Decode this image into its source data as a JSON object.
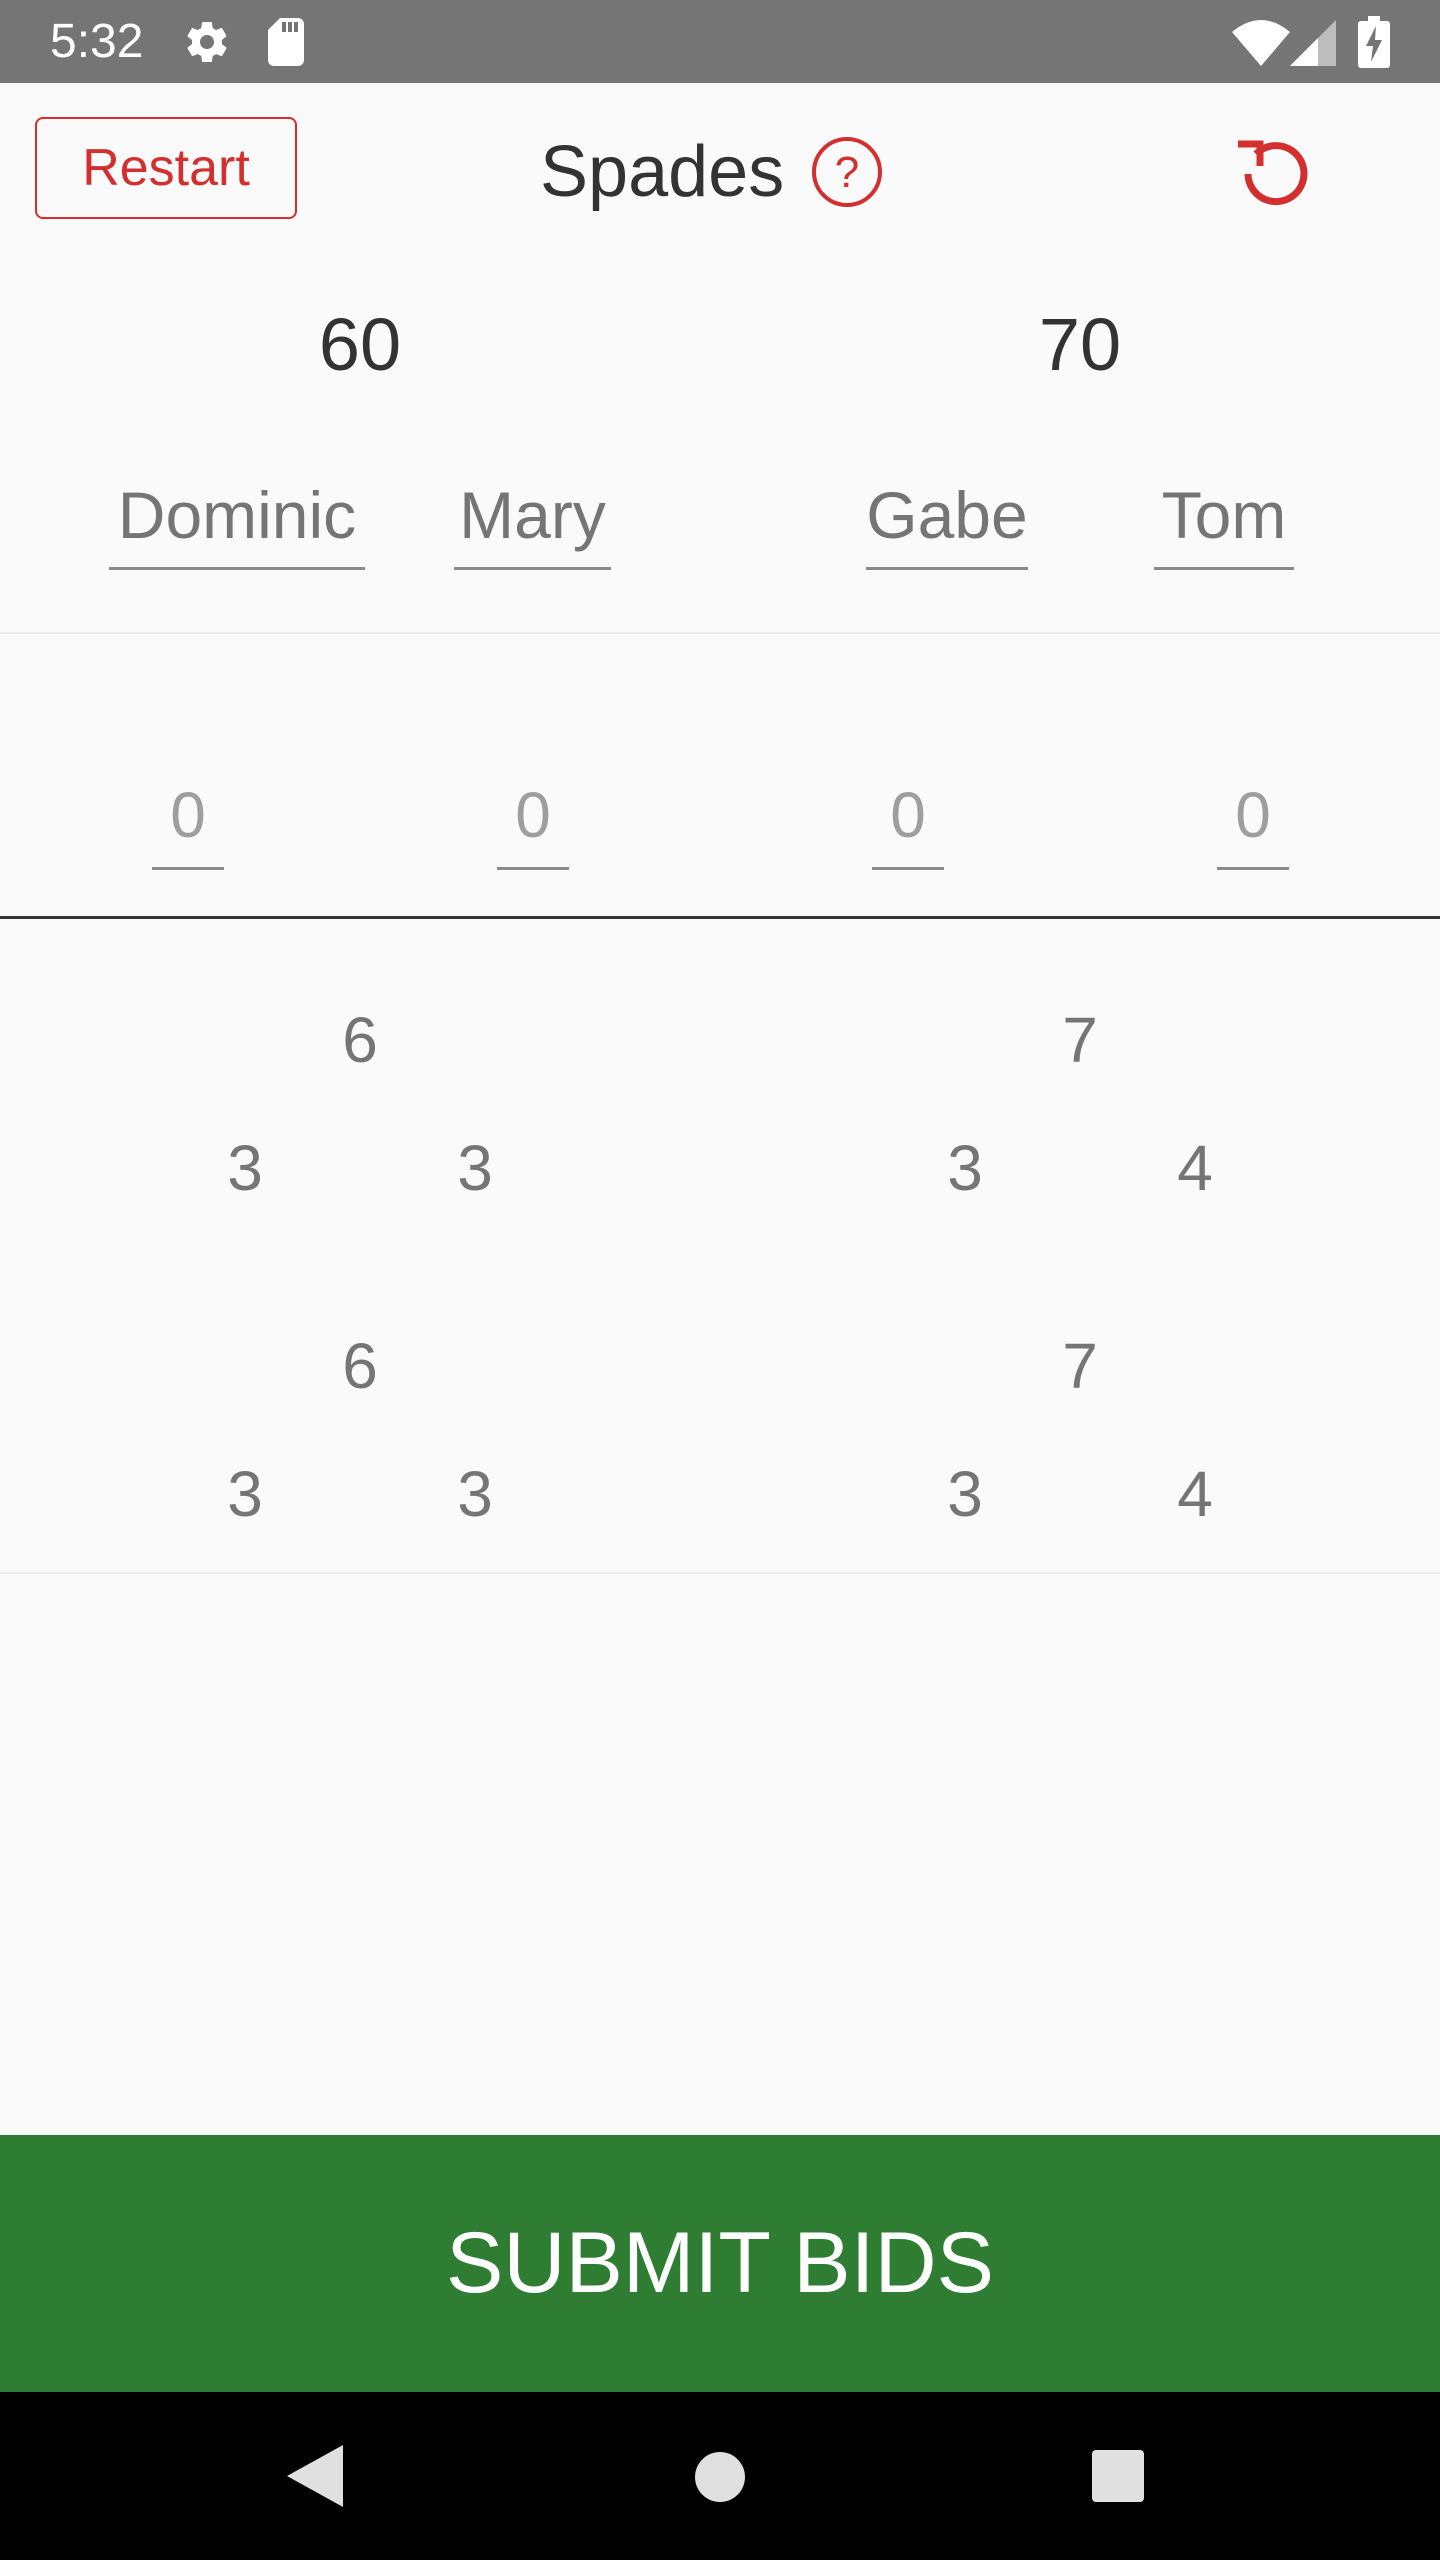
{
  "status_bar": {
    "time": "5:32",
    "icons": [
      "gear-icon",
      "sd-card-icon",
      "wifi-icon",
      "signal-icon",
      "battery-charging-icon"
    ]
  },
  "header": {
    "restart_label": "Restart",
    "title": "Spades",
    "help_icon": "help-circle-icon",
    "undo_icon": "undo-icon"
  },
  "teams": [
    {
      "score": "60",
      "players": [
        "Dominic",
        "Mary"
      ]
    },
    {
      "score": "70",
      "players": [
        "Gabe",
        "Tom"
      ]
    }
  ],
  "bids": [
    "0",
    "0",
    "0",
    "0"
  ],
  "rounds": [
    {
      "team1_total": "6",
      "team1_players": [
        "3",
        "3"
      ],
      "team2_total": "7",
      "team2_players": [
        "3",
        "4"
      ]
    },
    {
      "team1_total": "6",
      "team1_players": [
        "3",
        "3"
      ],
      "team2_total": "7",
      "team2_players": [
        "3",
        "4"
      ]
    }
  ],
  "submit_label": "SUBMIT BIDS",
  "colors": {
    "accent_red": "#d32f2f",
    "submit_green": "#2e7d32",
    "status_bar": "#757575"
  }
}
